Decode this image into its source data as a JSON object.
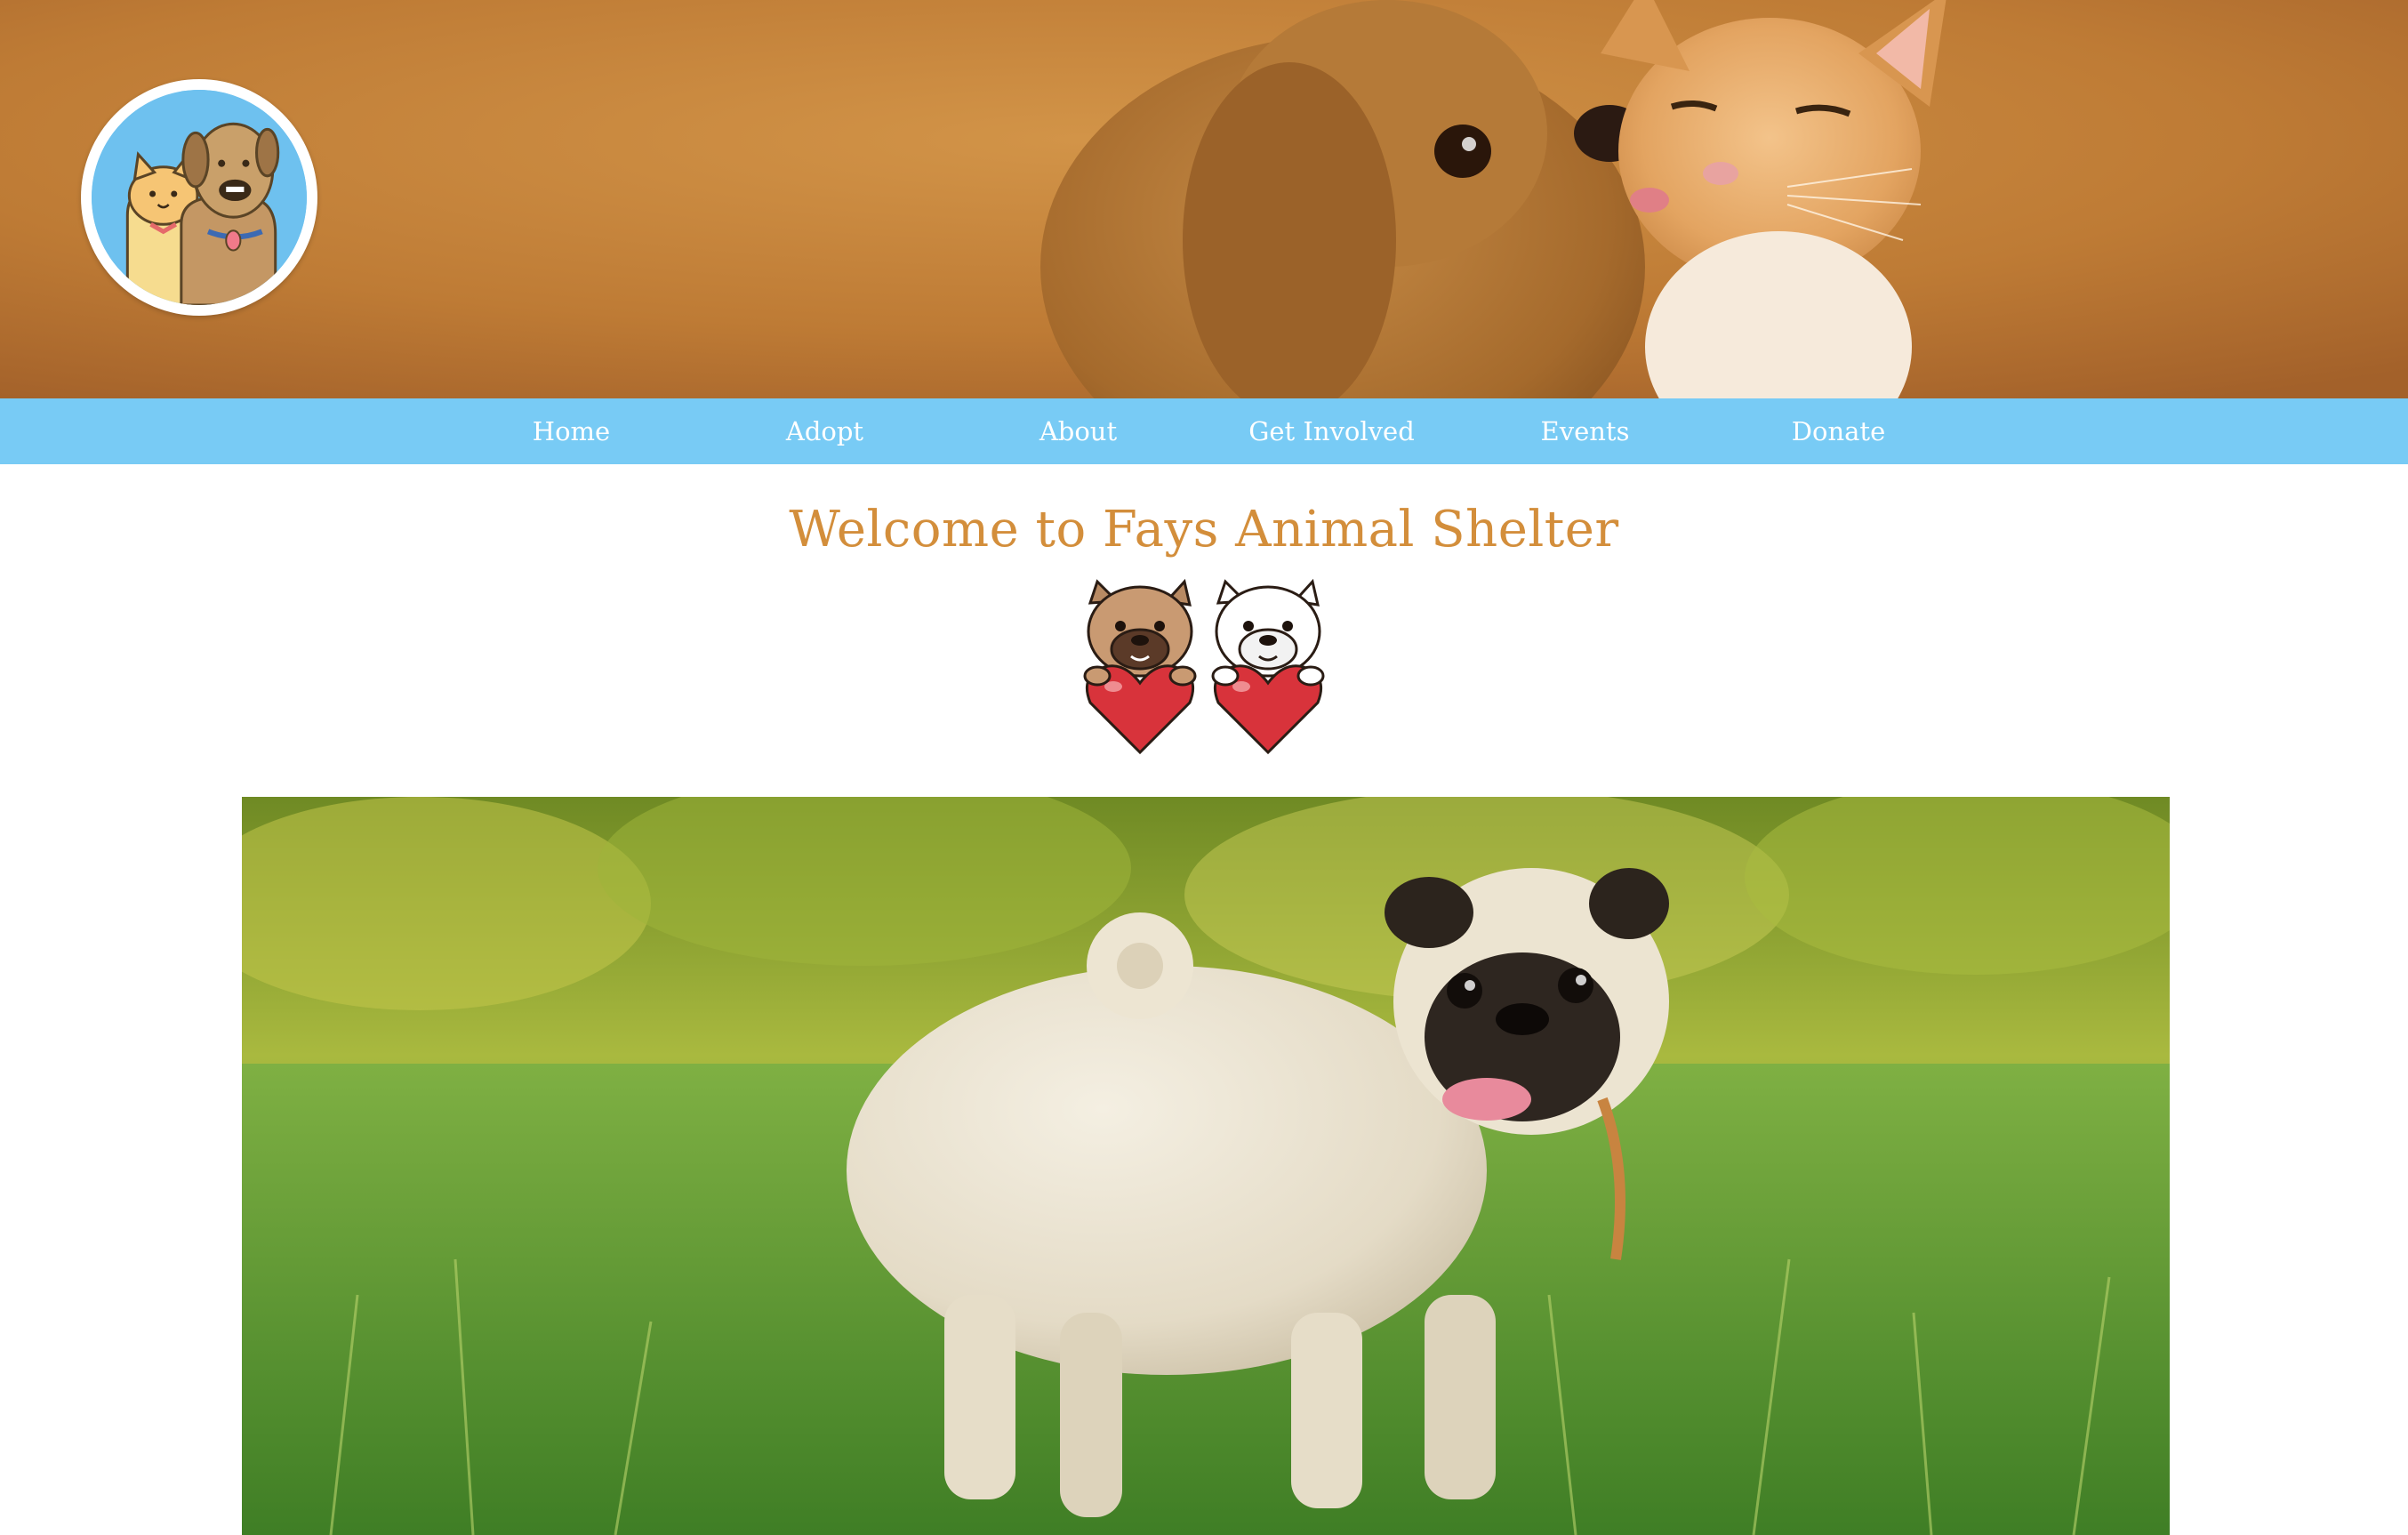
{
  "header": {
    "logo_icon": "cat-and-dog-cartoon-logo",
    "banner_image": "puppy-kissing-kitten-photo",
    "colors": {
      "banner_bg": "#c07d36",
      "logo_ring": "#6ec1ef"
    }
  },
  "nav": {
    "items": [
      {
        "label": "Home"
      },
      {
        "label": "Adopt"
      },
      {
        "label": "About"
      },
      {
        "label": "Get Involved"
      },
      {
        "label": "Events"
      },
      {
        "label": "Donate"
      }
    ],
    "colors": {
      "bg": "#78cbf5",
      "text": "#ffffff"
    }
  },
  "main": {
    "title": "Welcome to Fays Animal Shelter",
    "title_color": "#d38e3b",
    "decoration_icon": "bulldogs-with-hearts-icon",
    "hero_image": "pug-in-grass-photo"
  }
}
